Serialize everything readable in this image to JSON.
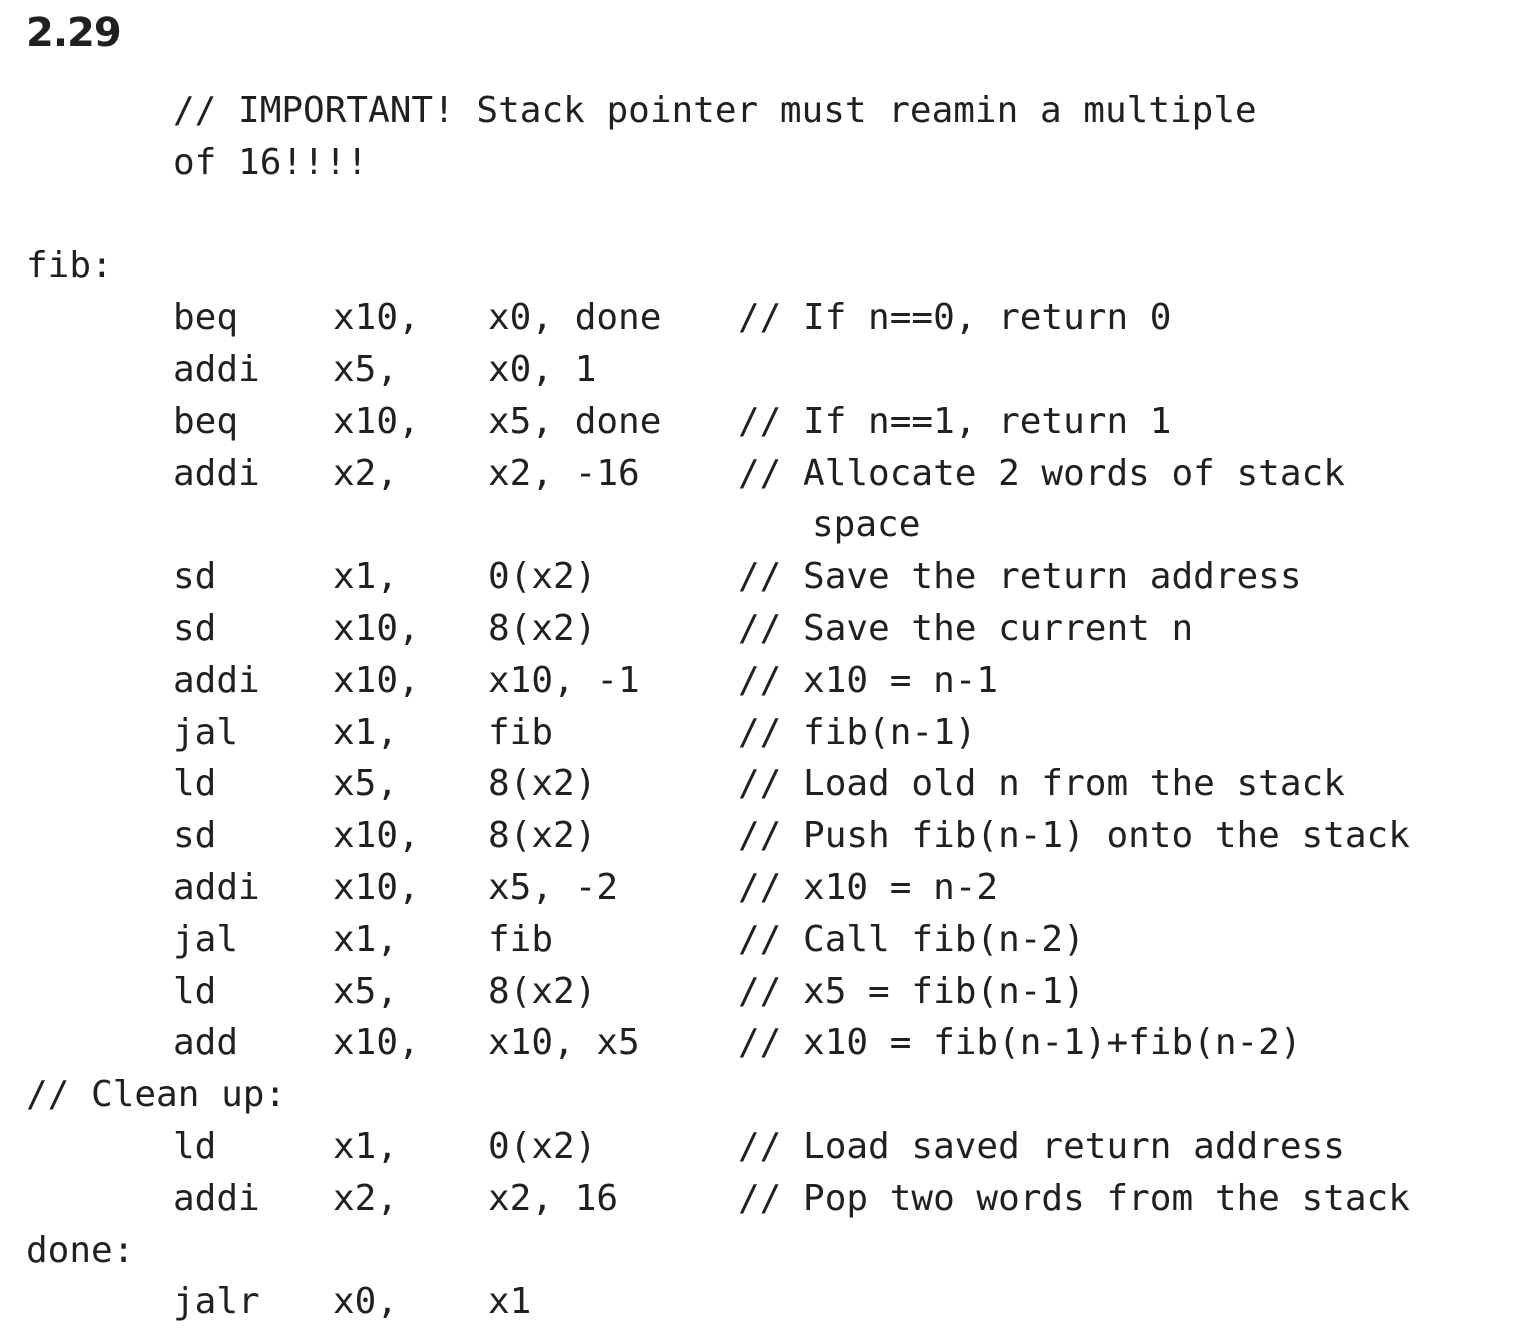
{
  "exercise_number": "2.29",
  "lines": [
    {
      "kind": "comment",
      "text": "// IMPORTANT! Stack pointer must reamin a multiple"
    },
    {
      "kind": "comment",
      "text": "of 16!!!!"
    },
    {
      "kind": "blank"
    },
    {
      "kind": "label",
      "text": "fib:"
    },
    {
      "kind": "instr",
      "op": "beq",
      "a1": "x10,",
      "a2": "x0, done",
      "comment": "// If n==0, return 0"
    },
    {
      "kind": "instr",
      "op": "addi",
      "a1": "x5,",
      "a2": "x0, 1",
      "comment": ""
    },
    {
      "kind": "instr",
      "op": "beq",
      "a1": "x10,",
      "a2": "x5, done",
      "comment": "// If n==1, return 1"
    },
    {
      "kind": "instr",
      "op": "addi",
      "a1": "x2,",
      "a2": "x2, -16",
      "comment": "// Allocate 2 words of stack"
    },
    {
      "kind": "cont",
      "text": "space"
    },
    {
      "kind": "instr",
      "op": "sd",
      "a1": "x1,",
      "a2": "0(x2)",
      "comment": "// Save the return address"
    },
    {
      "kind": "instr",
      "op": "sd",
      "a1": "x10,",
      "a2": "8(x2)",
      "comment": "// Save the current n"
    },
    {
      "kind": "instr",
      "op": "addi",
      "a1": "x10,",
      "a2": "x10, -1",
      "comment": "// x10 = n-1"
    },
    {
      "kind": "instr",
      "op": "jal",
      "a1": "x1,",
      "a2": "fib",
      "comment": "// fib(n-1)"
    },
    {
      "kind": "instr",
      "op": "ld",
      "a1": "x5,",
      "a2": "8(x2)",
      "comment": "// Load old n from the stack"
    },
    {
      "kind": "instr",
      "op": "sd",
      "a1": "x10,",
      "a2": "8(x2)",
      "comment": "// Push fib(n-1) onto the stack"
    },
    {
      "kind": "instr",
      "op": "addi",
      "a1": "x10,",
      "a2": "x5, -2",
      "comment": "// x10 = n-2"
    },
    {
      "kind": "instr",
      "op": "jal",
      "a1": "x1,",
      "a2": "fib",
      "comment": "// Call fib(n-2)"
    },
    {
      "kind": "instr",
      "op": "ld",
      "a1": "x5,",
      "a2": "8(x2)",
      "comment": "// x5 = fib(n-1)"
    },
    {
      "kind": "instr",
      "op": "add",
      "a1": "x10,",
      "a2": "x10, x5",
      "comment": "// x10 = fib(n-1)+fib(n-2)"
    },
    {
      "kind": "label",
      "text": "// Clean up:"
    },
    {
      "kind": "instr",
      "op": "ld",
      "a1": "x1,",
      "a2": "0(x2)",
      "comment": "// Load saved return address"
    },
    {
      "kind": "instr",
      "op": "addi",
      "a1": "x2,",
      "a2": "x2, 16",
      "comment": "// Pop two words from the stack"
    },
    {
      "kind": "label",
      "text": "done:"
    },
    {
      "kind": "instr",
      "op": "jalr",
      "a1": "x0,",
      "a2": "x1",
      "comment": ""
    }
  ]
}
